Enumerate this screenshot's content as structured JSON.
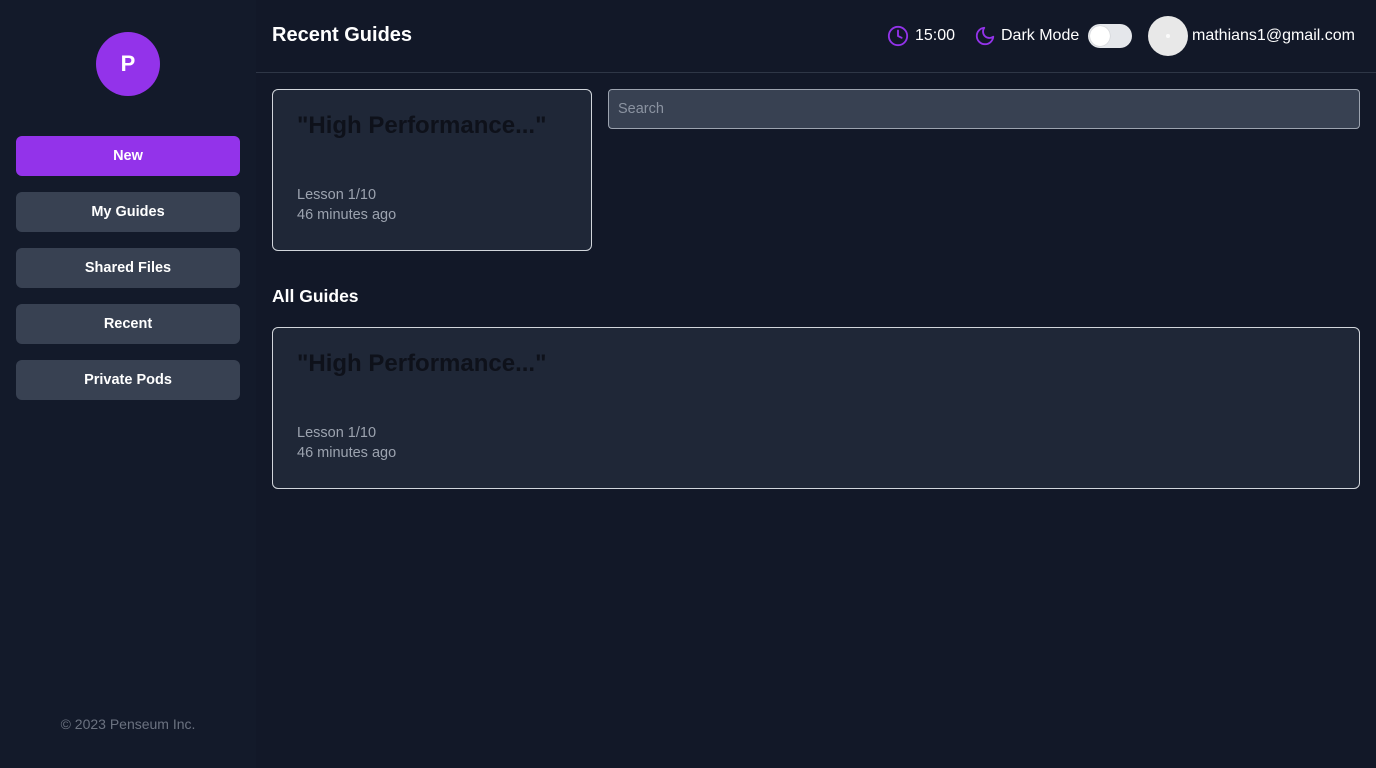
{
  "sidebar": {
    "logo_letter": "P",
    "items": [
      {
        "label": "New"
      },
      {
        "label": "My Guides"
      },
      {
        "label": "Shared Files"
      },
      {
        "label": "Recent"
      },
      {
        "label": "Private Pods"
      }
    ],
    "copyright": "© 2023 Penseum Inc."
  },
  "header": {
    "title": "Recent Guides",
    "timer": "15:00",
    "dark_mode_label": "Dark Mode",
    "dark_mode_on": false,
    "user_email": "mathians1@gmail.com"
  },
  "recent": {
    "cards": [
      {
        "title": "\"High Performance...\"",
        "lesson": "Lesson 1/10",
        "time": "46 minutes ago"
      }
    ]
  },
  "search": {
    "placeholder": "Search",
    "value": ""
  },
  "all_guides": {
    "heading": "All Guides",
    "cards": [
      {
        "title": "\"High Performance...\"",
        "lesson": "Lesson 1/10",
        "time": "46 minutes ago"
      }
    ]
  },
  "colors": {
    "accent": "#9333ea",
    "background": "#121828",
    "card": "#1f2737",
    "button": "#384152"
  }
}
